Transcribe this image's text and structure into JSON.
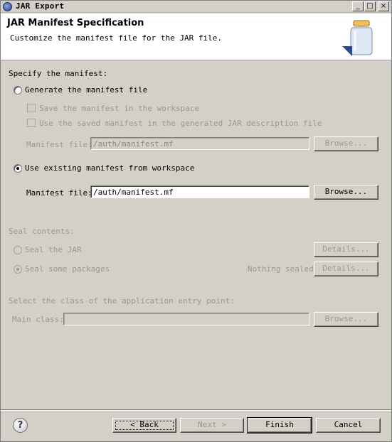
{
  "window": {
    "title": "JAR Export"
  },
  "title_buttons": {
    "minimize": "_",
    "maximize": "□",
    "close": "×"
  },
  "header": {
    "title": "JAR Manifest Specification",
    "subtitle": "Customize the manifest file for the JAR file."
  },
  "manifest": {
    "section_label": "Specify the manifest:",
    "generate_label": "Generate the manifest file",
    "generate_selected": false,
    "save_label": "Save the manifest in the workspace",
    "reuse_label": "Use the saved manifest in the generated JAR description file",
    "generated_file_label": "Manifest file:",
    "generated_file_value": "/auth/manifest.mf",
    "generated_browse": "Browse...",
    "existing_label": "Use existing manifest from workspace",
    "existing_selected": true,
    "existing_file_label": "Manifest file:",
    "existing_file_value": "/auth/manifest.mf",
    "existing_browse": "Browse..."
  },
  "seal": {
    "section_label": "Seal contents:",
    "seal_jar_label": "Seal the JAR",
    "seal_packages_label": "Seal some packages",
    "nothing_sealed": "Nothing sealed",
    "details_1": "Details...",
    "details_2": "Details..."
  },
  "entry": {
    "section_label": "Select the class of the application entry point:",
    "main_class_label": "Main class:",
    "main_class_value": "",
    "browse": "Browse..."
  },
  "footer": {
    "help": "?",
    "back": "< Back",
    "next": "Next >",
    "finish": "Finish",
    "cancel": "Cancel"
  },
  "colors": {
    "dialog_bg": "#d4d0c8",
    "header_bg": "#ffffff",
    "disabled_text": "#9a9892"
  }
}
